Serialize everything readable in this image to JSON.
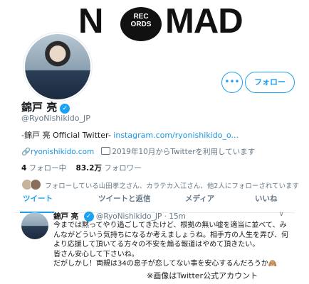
{
  "logo": {
    "n": "N",
    "small": "REC\nORDS",
    "mad": "MAD"
  },
  "profile": {
    "name": "錦戸 亮",
    "handle": "@RyoNishikido_JP",
    "bio_prefix": "-錦戸 亮 Official Twitter- ",
    "bio_link": "instagram.com/ryonishikido_o...",
    "website": "ryonishikido.com",
    "joined": "2019年10月からTwitterを利用しています",
    "following_count": "4",
    "following_label": " フォロー中",
    "followers_count": "83.2万",
    "followers_label": " フォロワー",
    "followed_by": "フォローしている山田孝之さん、カラテカ入江さん、他2人にフォローされています"
  },
  "buttons": {
    "more": "•••",
    "follow": "フォロー"
  },
  "tabs": [
    "ツイート",
    "ツイートと返信",
    "メディア",
    "いいね"
  ],
  "tweet": {
    "name": "錦戸 亮",
    "handle": "@RyoNishikido_JP",
    "time": "· 15m",
    "lines": [
      "今までは黙ってやり過ごしてきたけど、根拠の無い嘘を適当に並べて、み",
      "んながどういう気持ちになるか考えましょうね。相手方の人生を弄び、何",
      "より応援して頂いてる方々の不安を煽る報道はやめて頂きたい。",
      "皆さん安心して下さいね。",
      "だがしかし！両親は34の息子が恋してない事を安心するんだろうか🙈"
    ]
  },
  "caption": "※画像はTwitter公式アカウント",
  "colors": {
    "accent": "#1da1f2",
    "muted": "#657786"
  }
}
